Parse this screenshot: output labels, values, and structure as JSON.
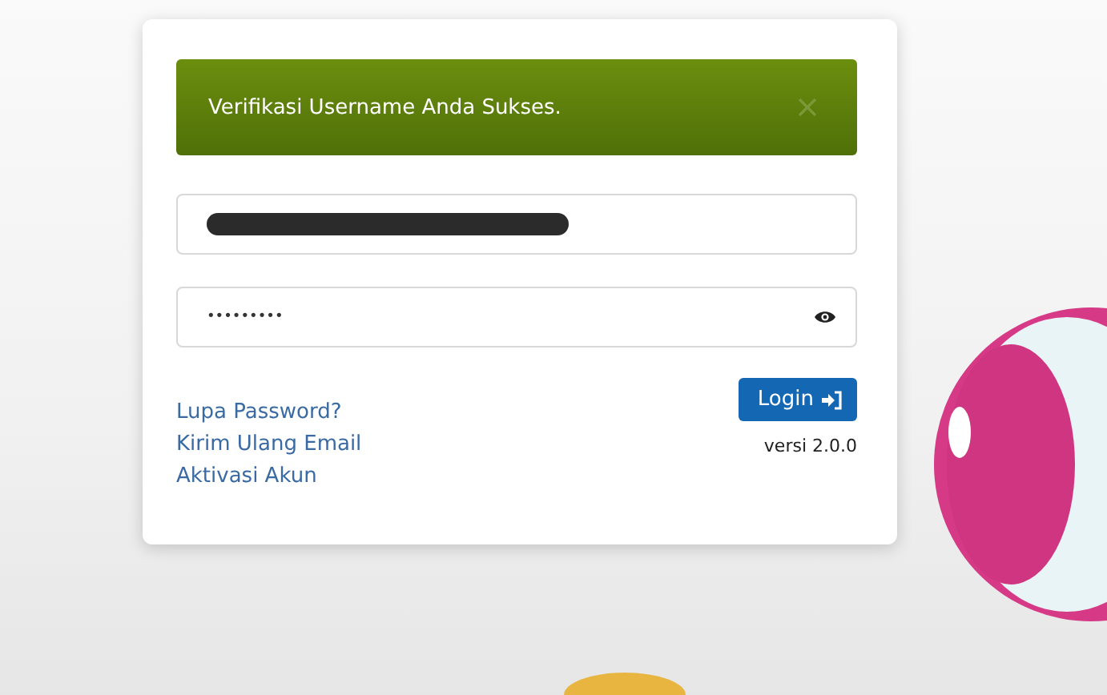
{
  "alert": {
    "message": "Verifikasi Username Anda Sukses."
  },
  "password_field": {
    "value": "•••••••••"
  },
  "links": [
    "Lupa Password?",
    "Kirim Ulang Email",
    "Aktivasi Akun"
  ],
  "login_button": {
    "label": "Login"
  },
  "version": "versi 2.0.0"
}
